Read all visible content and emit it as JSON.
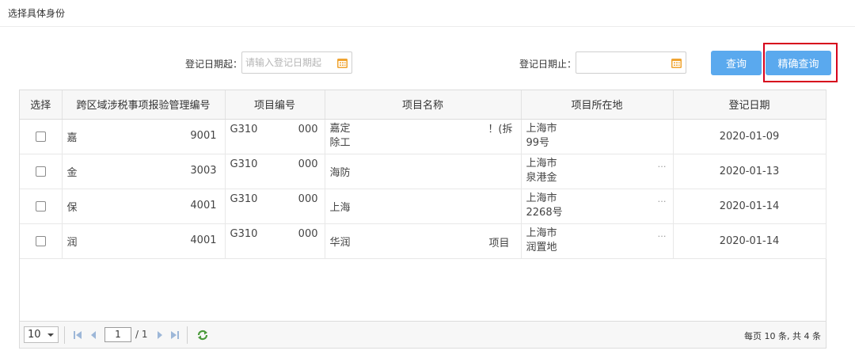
{
  "dialog": {
    "title": "选择具体身份"
  },
  "filters": {
    "start_label": "登记日期起：",
    "start_placeholder": "请输入登记日期起",
    "start_value": "",
    "end_label": "登记日期止：",
    "end_placeholder": "",
    "end_value": ""
  },
  "buttons": {
    "query": "查询",
    "exact_query": "精确查询"
  },
  "table": {
    "columns": [
      "选择",
      "跨区域涉税事项报验管理编号",
      "项目编号",
      "项目名称",
      "项目所在地",
      "登记日期"
    ],
    "rows": [
      {
        "mgmt_no_prefix": "嘉",
        "mgmt_no_suffix": "9001",
        "project_no_prefix": "G310",
        "project_no_suffix": "000",
        "name_line1_left": "嘉定",
        "name_line1_right": "！(拆",
        "name_line2": "除工",
        "location_line1": "上海市",
        "location_line2": "99号",
        "location_right": "",
        "date": "2020-01-09"
      },
      {
        "mgmt_no_prefix": "金",
        "mgmt_no_suffix": "3003",
        "project_no_prefix": "G310",
        "project_no_suffix": "000",
        "name_line1_left": "海防",
        "name_line1_right": "",
        "name_line2": "",
        "location_line1": "上海市",
        "location_line2": "泉港金",
        "location_right": "…",
        "date": "2020-01-13"
      },
      {
        "mgmt_no_prefix": "保",
        "mgmt_no_suffix": "4001",
        "project_no_prefix": "G310",
        "project_no_suffix": "000",
        "name_line1_left": "上海",
        "name_line1_right": "",
        "name_line2": "",
        "location_line1": "上海市",
        "location_line2": "2268号",
        "location_right": "…",
        "date": "2020-01-14"
      },
      {
        "mgmt_no_prefix": "润",
        "mgmt_no_suffix": "4001",
        "project_no_prefix": "G310",
        "project_no_suffix": "000",
        "name_line1_left": "华润",
        "name_line1_right": "项目",
        "name_line2": "",
        "location_line1": "上海市",
        "location_line2": "润置地",
        "location_right": "…",
        "date": "2020-01-14"
      }
    ]
  },
  "pager": {
    "page_size": "10",
    "current_page": "1",
    "total_pages": "/ 1",
    "summary": "每页 10 条, 共 4 条"
  },
  "colors": {
    "button_blue": "#5aa9ee",
    "highlight_red": "#d7001c",
    "calendar_icon": "#f0a431"
  }
}
